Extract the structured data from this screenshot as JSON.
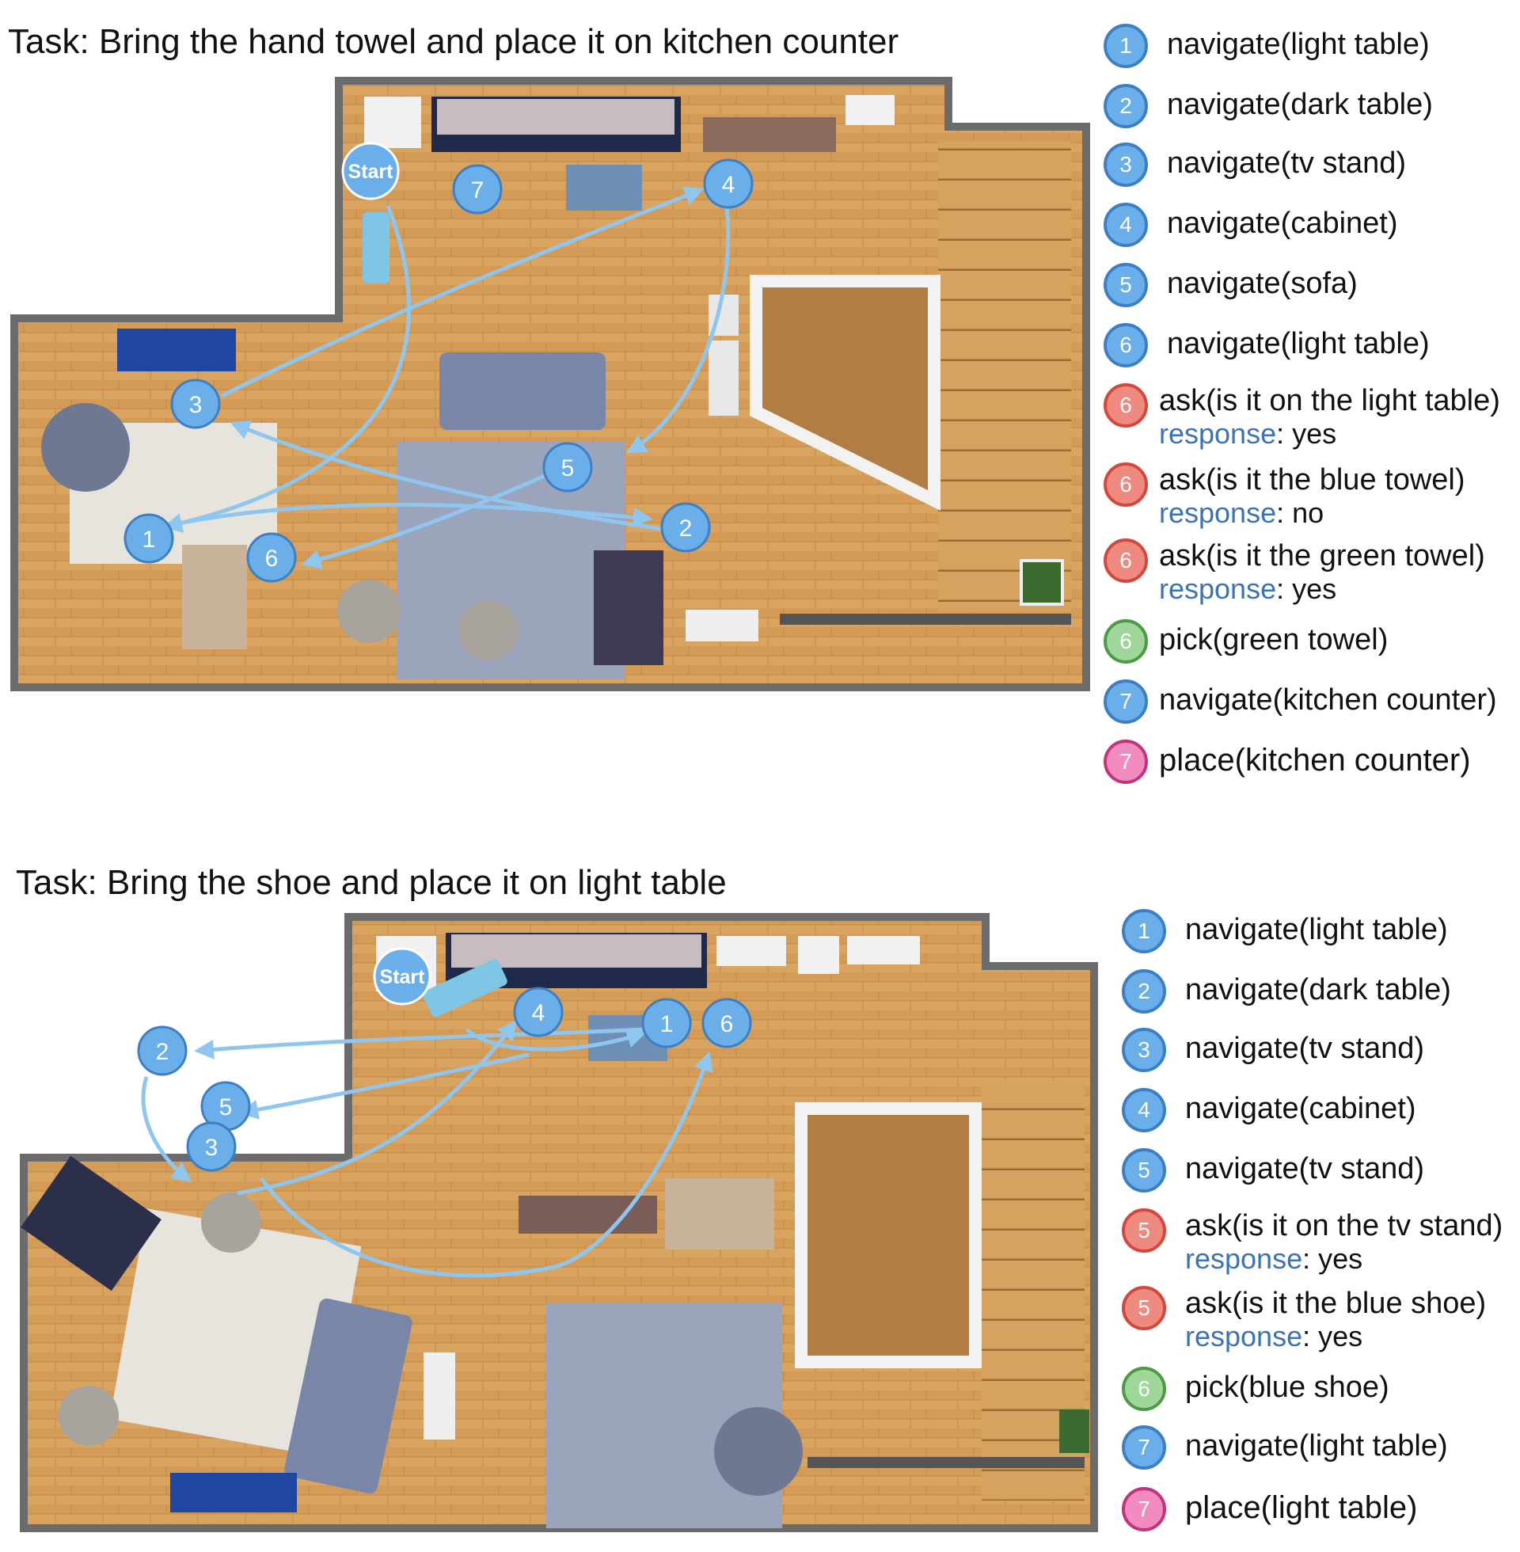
{
  "colors": {
    "navigate": "#6aaeea",
    "ask": "#ef8a80",
    "pick": "#9fd79a",
    "place": "#f28bc0",
    "path": "#8ec6f0",
    "floor": "#d9a45f",
    "wall": "#6b6b6b"
  },
  "panels": [
    {
      "task": "Task: Bring the hand towel and place it on kitchen counter",
      "start_label": "Start",
      "map_nodes": [
        "1",
        "2",
        "3",
        "4",
        "5",
        "6",
        "7"
      ],
      "steps": [
        {
          "num": "1",
          "kind": "navigate",
          "text": "navigate(light table)"
        },
        {
          "num": "2",
          "kind": "navigate",
          "text": "navigate(dark table)"
        },
        {
          "num": "3",
          "kind": "navigate",
          "text": "navigate(tv stand)"
        },
        {
          "num": "4",
          "kind": "navigate",
          "text": "navigate(cabinet)"
        },
        {
          "num": "5",
          "kind": "navigate",
          "text": "navigate(sofa)"
        },
        {
          "num": "6",
          "kind": "navigate",
          "text": "navigate(light table)"
        },
        {
          "num": "6",
          "kind": "ask",
          "text": "ask(is it on the light table)",
          "response_label": "response",
          "response": ": yes"
        },
        {
          "num": "6",
          "kind": "ask",
          "text": "ask(is it the blue towel)",
          "response_label": "response",
          "response": ": no"
        },
        {
          "num": "6",
          "kind": "ask",
          "text": "ask(is it the green towel)",
          "response_label": "response",
          "response": ": yes"
        },
        {
          "num": "6",
          "kind": "pick",
          "text": "pick(green towel)"
        },
        {
          "num": "7",
          "kind": "navigate",
          "text": "navigate(kitchen counter)"
        },
        {
          "num": "7",
          "kind": "place",
          "text": "place(kitchen counter)"
        }
      ]
    },
    {
      "task": "Task: Bring the shoe and place it on light table",
      "start_label": "Start",
      "map_nodes": [
        "1",
        "2",
        "3",
        "4",
        "5",
        "6"
      ],
      "steps": [
        {
          "num": "1",
          "kind": "navigate",
          "text": "navigate(light table)"
        },
        {
          "num": "2",
          "kind": "navigate",
          "text": "navigate(dark table)"
        },
        {
          "num": "3",
          "kind": "navigate",
          "text": "navigate(tv stand)"
        },
        {
          "num": "4",
          "kind": "navigate",
          "text": "navigate(cabinet)"
        },
        {
          "num": "5",
          "kind": "navigate",
          "text": "navigate(tv stand)"
        },
        {
          "num": "5",
          "kind": "ask",
          "text": "ask(is it on the tv stand)",
          "response_label": "response",
          "response": ": yes"
        },
        {
          "num": "5",
          "kind": "ask",
          "text": "ask(is it the blue shoe)",
          "response_label": "response",
          "response": ": yes"
        },
        {
          "num": "6",
          "kind": "pick",
          "text": "pick(blue shoe)"
        },
        {
          "num": "7",
          "kind": "navigate",
          "text": "navigate(light table)"
        },
        {
          "num": "7",
          "kind": "place",
          "text": "place(light table)"
        }
      ]
    }
  ]
}
